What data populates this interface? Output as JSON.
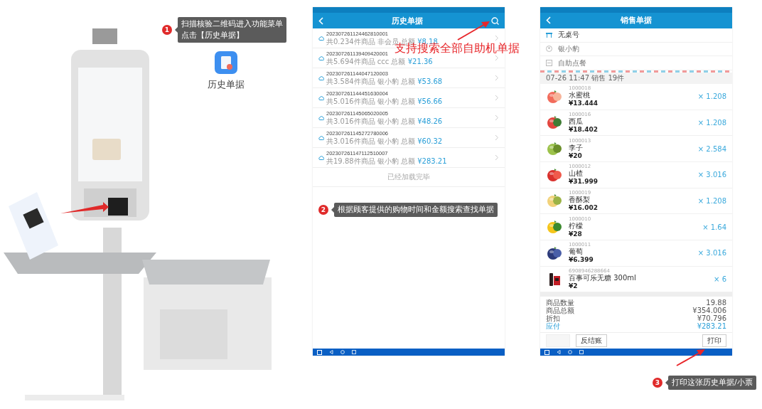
{
  "step1": {
    "number": "1",
    "lines": [
      "扫描核验二维码进入功能菜单",
      "点击【历史单据】"
    ]
  },
  "app_shortcut": {
    "label": "历史单据"
  },
  "history_screen": {
    "title": "历史单据",
    "orders": [
      {
        "number": "202307261124462810001",
        "summary": "共0.234件商品 非会员 总额",
        "total": "¥8.18"
      },
      {
        "number": "202307261139409420001",
        "summary": "共5.694件商品 ccc 总额",
        "total": "¥21.36"
      },
      {
        "number": "202307261144047120003",
        "summary": "共3.584件商品 银小豹 总额",
        "total": "¥53.68"
      },
      {
        "number": "202307261144451630004",
        "summary": "共5.016件商品 银小豹 总额",
        "total": "¥56.66"
      },
      {
        "number": "202307261145065020005",
        "summary": "共3.016件商品 银小豹 总额",
        "total": "¥48.26"
      },
      {
        "number": "202307261145272780006",
        "summary": "共3.016件商品 银小豹 总额",
        "total": "¥60.32"
      },
      {
        "number": "202307261147112510007",
        "summary": "共19.88件商品 银小豹 总额",
        "total": "¥283.21"
      }
    ],
    "footer": "已经加载完毕"
  },
  "search_note": "支持搜索全部自助机单据",
  "step2": {
    "number": "2",
    "text": "根据顾客提供的购物时间和金额搜索查找单据"
  },
  "sale_screen": {
    "title": "销售单据",
    "info": [
      {
        "kind": "table",
        "text": "无桌号"
      },
      {
        "kind": "member",
        "text": "银小豹"
      },
      {
        "kind": "channel",
        "text": "自助点餐"
      }
    ],
    "header": "07-26 11:47 销售 19件",
    "items": [
      {
        "code": "1000018",
        "name": "水蜜桃",
        "price": "¥13.444",
        "quantity": "× 1.208"
      },
      {
        "code": "1000016",
        "name": "西瓜",
        "price": "¥18.402",
        "quantity": "× 1.208"
      },
      {
        "code": "1000013",
        "name": "李子",
        "price": "¥20",
        "quantity": "× 2.584"
      },
      {
        "code": "1000012",
        "name": "山楂",
        "price": "¥31.999",
        "quantity": "× 3.016"
      },
      {
        "code": "1000019",
        "name": "香酥梨",
        "price": "¥16.002",
        "quantity": "× 1.208"
      },
      {
        "code": "1000010",
        "name": "柠檬",
        "price": "¥28",
        "quantity": "× 1.64"
      },
      {
        "code": "1000011",
        "name": "葡萄",
        "price": "¥6.399",
        "quantity": "× 3.016"
      },
      {
        "code": "6908946288664",
        "name": "百事可乐无糖 300ml",
        "price": "¥2",
        "quantity": "× 6"
      }
    ],
    "summary": [
      {
        "kind": "plain",
        "label": "商品数量",
        "value": "19.88"
      },
      {
        "kind": "plain",
        "label": "商品总额",
        "value": "¥354.006"
      },
      {
        "kind": "plain",
        "label": "折扣",
        "value": "¥70.796"
      },
      {
        "kind": "due",
        "label": "应付",
        "value": "¥283.21"
      }
    ],
    "buttons": [
      {
        "disabled": true
      },
      {
        "label": "反结账",
        "disabled": false
      },
      {
        "label": "打印",
        "disabled": false
      }
    ]
  },
  "step3": {
    "number": "3",
    "text": "打印这张历史单据/小票"
  }
}
